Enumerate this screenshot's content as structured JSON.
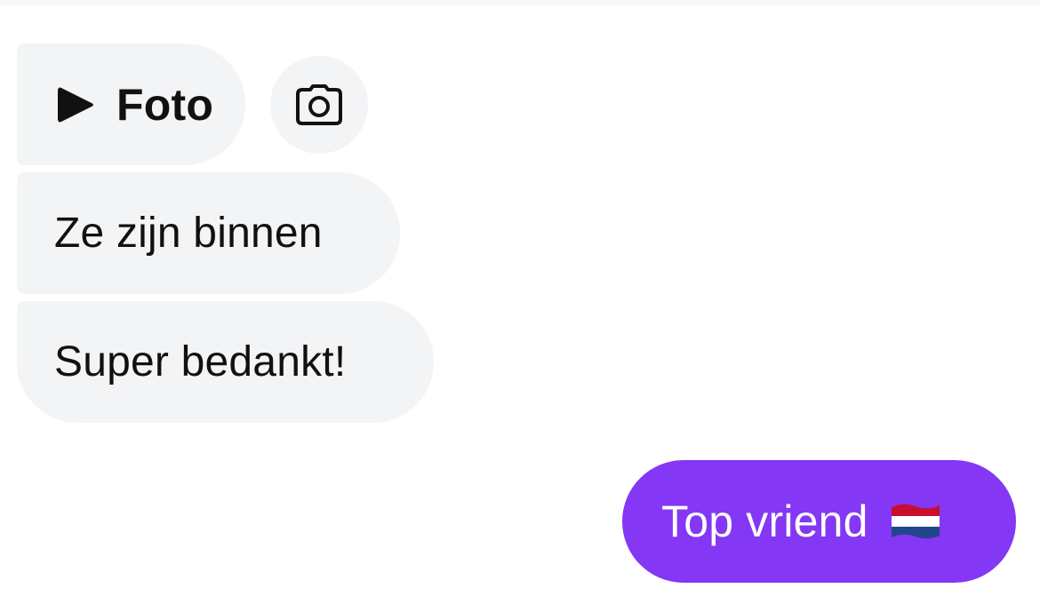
{
  "thread": {
    "photo_label": "Foto",
    "messages_in": [
      "Ze zijn binnen",
      "Super bedankt!"
    ],
    "message_out": "Top vriend",
    "message_out_emoji": "netherlands-flag-icon"
  },
  "colors": {
    "incoming_bubble": "#f3f4f6",
    "outgoing_bubble": "#8437f5",
    "text_dark": "#111111",
    "text_light": "#ffffff"
  }
}
